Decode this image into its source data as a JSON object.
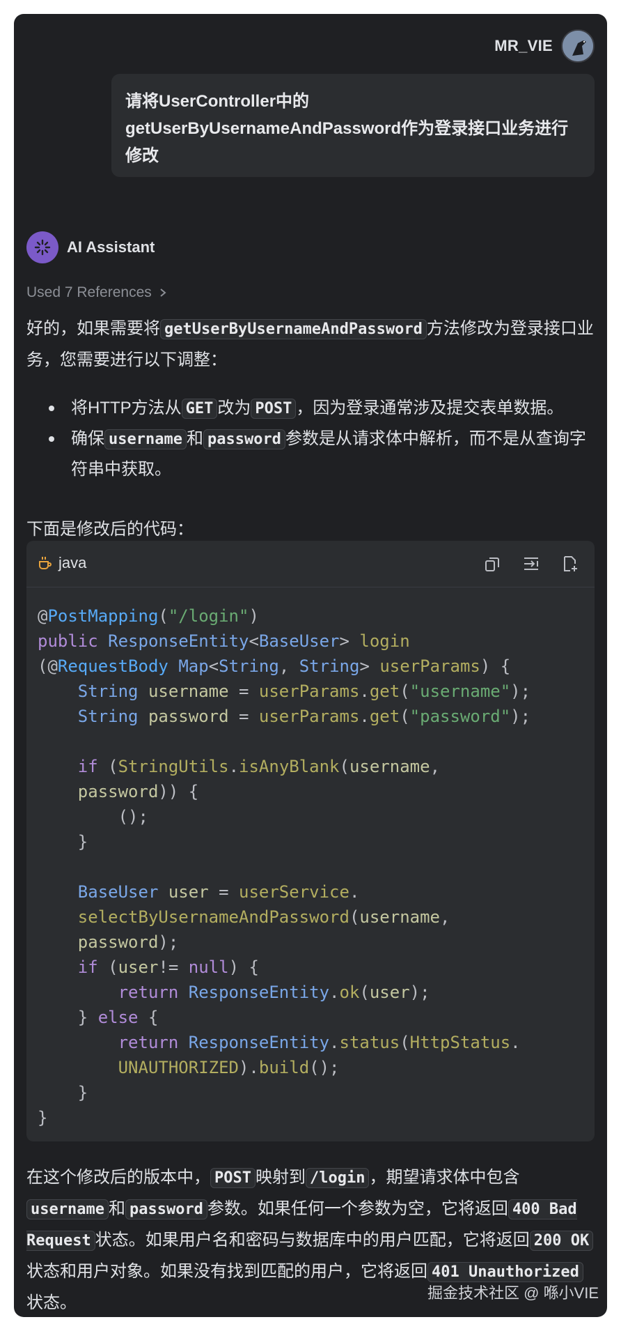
{
  "user": {
    "name": "MR_VIE",
    "message": "请将UserController中的getUserByUsernameAndPassword作为登录接口业务进行修改"
  },
  "assistant": {
    "name": "AI Assistant",
    "references": "Used 7 References",
    "intro_a": "好的，如果需要将",
    "intro_code": "getUserByUsernameAndPassword",
    "intro_b": "方法修改为登录接口业务，您需要进行以下调整：",
    "bullets": [
      {
        "a": "将HTTP方法从",
        "c1": "GET",
        "b": "改为",
        "c2": "POST",
        "d": "，因为登录通常涉及提交表单数据。"
      },
      {
        "a": "确保",
        "c1": "username",
        "b": "和",
        "c2": "password",
        "d": "参数是从请求体中解析，而不是从查询字符串中获取。"
      }
    ],
    "code_intro": "下面是修改后的代码："
  },
  "code_block": {
    "language": "java",
    "actions": [
      "copy-icon",
      "insert-icon",
      "new-file-icon"
    ],
    "lines": [
      "@PostMapping(\"/login\")",
      "public ResponseEntity<BaseUser> login",
      "(@RequestBody Map<String, String> userParams) {",
      "    String username = userParams.get(\"username\");",
      "    String password = userParams.get(\"password\");",
      "",
      "    if (StringUtils.isAnyBlank(username,",
      "    password)) {",
      "        ();",
      "    }",
      "",
      "    BaseUser user = userService.",
      "    selectByUsernameAndPassword(username,",
      "    password);",
      "    if (user!= null) {",
      "        return ResponseEntity.ok(user);",
      "    } else {",
      "        return ResponseEntity.status(HttpStatus.",
      "        UNAUTHORIZED).build();",
      "    }",
      "}"
    ]
  },
  "summary": {
    "t1": "在这个修改后的版本中，",
    "c1": "POST",
    "t2": "映射到",
    "c2": "/login",
    "t3": "，期望请求体中包含",
    "c3": "username",
    "t4": "和",
    "c4": "password",
    "t5": "参数。如果任何一个参数为空，它将返回",
    "c5": "400 Bad Request",
    "t6": "状态。如果用户名和密码与数据库中的用户匹配，它将返回",
    "c6": "200 OK",
    "t7": "状态和用户对象。如果没有找到匹配的用户，它将返回",
    "c7": "401 Unauthorized",
    "t8": "状态。"
  },
  "watermark": "掘金技术社区 @ 喺小VIE",
  "colors": {
    "panel": "#1f2023",
    "bubble": "#2b2d30",
    "accent": "#7b5ac8"
  }
}
